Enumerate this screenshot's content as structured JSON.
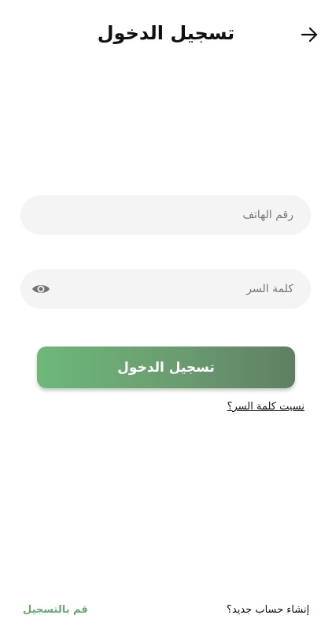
{
  "header": {
    "title": "تسجيل الدخول",
    "back_icon": "arrow-right-icon"
  },
  "form": {
    "phone_placeholder": "رقم الهاتف",
    "phone_value": "",
    "password_placeholder": "كلمة السر",
    "password_value": "",
    "password_toggle_icon": "eye-icon",
    "login_button_label": "تسجيل الدخول",
    "forgot_password_label": "نسيت كلمة السر؟"
  },
  "footer": {
    "new_account_label": "إنشاء حساب جديد؟",
    "register_label": "قم بالتسجيل"
  },
  "colors": {
    "accent_green": "#6aa874",
    "field_background": "#f4f4f4",
    "button_gradient_start": "#6db87a",
    "button_gradient_end": "#5f7f63"
  }
}
